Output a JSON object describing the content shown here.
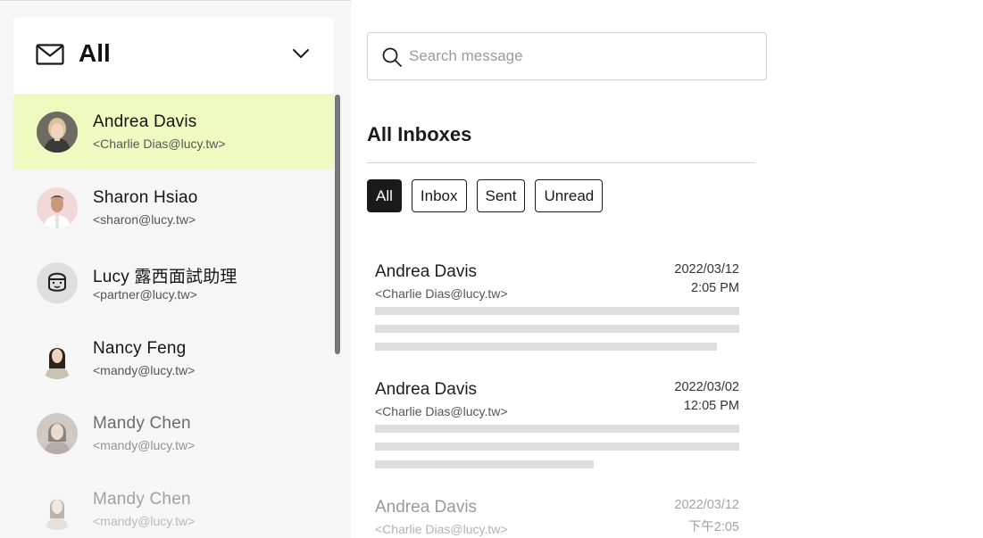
{
  "sidebar": {
    "folder_title": "All",
    "contacts": [
      {
        "name": "Andrea Davis",
        "email": "<Charlie Dias@lucy.tw>",
        "active": true
      },
      {
        "name": "Sharon Hsiao",
        "email": "<sharon@lucy.tw>"
      },
      {
        "name": "Lucy 露西面試助理",
        "email": "<partner@lucy.tw>"
      },
      {
        "name": "Nancy Feng",
        "email": "<mandy@lucy.tw>"
      },
      {
        "name": "Mandy Chen",
        "email": "<mandy@lucy.tw>"
      },
      {
        "name": "Mandy Chen",
        "email": "<mandy@lucy.tw>"
      }
    ]
  },
  "search": {
    "placeholder": "Search message"
  },
  "main": {
    "title": "All Inboxes",
    "filters": [
      "All",
      "Inbox",
      "Sent",
      "Unread"
    ],
    "selected_filter": "All",
    "messages": [
      {
        "sender": "Andrea Davis",
        "address": "<Charlie Dias@lucy.tw>",
        "date": "2022/03/12",
        "time": "2:05 PM"
      },
      {
        "sender": "Andrea Davis",
        "address": "<Charlie Dias@lucy.tw>",
        "date": "2022/03/02",
        "time": "12:05 PM"
      },
      {
        "sender": "Andrea Davis",
        "address": "<Charlie Dias@lucy.tw>",
        "date": "2022/03/12",
        "time": "下午2:05"
      }
    ]
  },
  "colors": {
    "active_row": "#eefac0",
    "sidebar_bg": "#f6f6f6",
    "chip_selected": "#1a1a1a",
    "preview_placeholder": "#dedede"
  },
  "icons": [
    "mail-icon",
    "chevron-down-icon",
    "search-icon"
  ]
}
